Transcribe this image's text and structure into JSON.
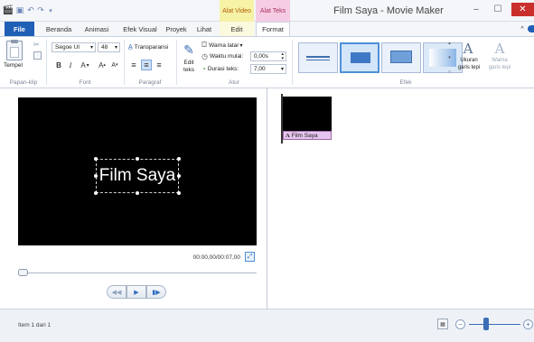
{
  "window": {
    "title": "Film Saya - Movie Maker",
    "minimize_icon": "minimize-icon",
    "maximize_icon": "maximize-icon",
    "close_icon": "close-icon"
  },
  "quick_access": {
    "icons": [
      "app-icon",
      "save-icon",
      "undo-icon",
      "redo-icon",
      "qat-dropdown-icon"
    ]
  },
  "context_tabs": {
    "video_tools": "Alat Video",
    "text_tools": "Alat Teks"
  },
  "tabs": {
    "file": "File",
    "home": "Beranda",
    "animations": "Animasi",
    "visual_effects": "Efek Visual",
    "project": "Proyek",
    "view": "Lihat",
    "edit": "Edit",
    "format": "Format"
  },
  "ribbon": {
    "clipboard": {
      "paste_label": "Tempel",
      "group_label": "Papan-klip"
    },
    "font": {
      "family_value": "Segoe UI",
      "size_value": "48",
      "bold_label": "B",
      "italic_label": "I",
      "font_color_label": "A",
      "grow_label": "A",
      "shrink_label": "A",
      "group_label": "Font"
    },
    "paragraph": {
      "transparency_label": "Transparansi",
      "group_label": "Paragraf"
    },
    "adjust": {
      "edit_text_label": "Edit\nteks",
      "background_color_label": "Warna latar",
      "start_time_label": "Waktu mulai:",
      "start_time_value": "0,00s",
      "duration_label": "Durasi teks:",
      "duration_value": "7,00",
      "group_label": "Atur"
    },
    "effects": {
      "group_label": "Efek",
      "outline_size_label": "Ukuran\ngaris tepi",
      "outline_color_label": "Warna\ngaris tepi",
      "selected_index": 1
    }
  },
  "preview": {
    "caption_text": "Film Saya",
    "time_display": "00:00,00/00:07,00",
    "seek_position": 0
  },
  "storyboard": {
    "clip_caption": "Film Saya",
    "caption_icon_label": "A"
  },
  "status": {
    "text": "Item 1 dari 1",
    "zoom_out_label": "−",
    "zoom_in_label": "+"
  },
  "colors": {
    "file_tab": "#1f5fb6",
    "video_tools": "#f6f2a6",
    "text_tools": "#f6cce4",
    "close_button": "#c9302c",
    "accent": "#3b6eb6"
  }
}
